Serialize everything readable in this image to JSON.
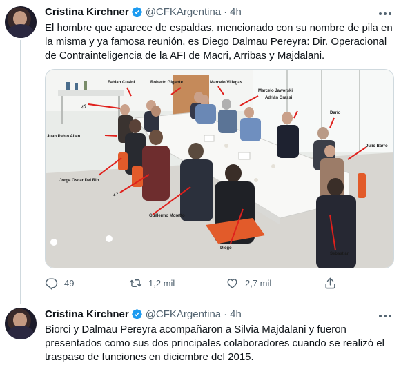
{
  "tweets": [
    {
      "author_name": "Cristina Kirchner",
      "handle": "@CFKArgentina",
      "separator": "·",
      "time": "4h",
      "text": "El hombre que aparece de espaldas, mencionado con su nombre de pila en la misma y ya famosa reunión, es Diego Dalmau Pereyra: Dir. Operacional de Contrainteligencia de la AFI de Macri, Arribas y Majdalani.",
      "photo_labels": {
        "fabian": "Fabian Cusini",
        "roberto": "Roberto Gigante",
        "marcelo_v": "Marcelo Villegas",
        "marcelo_j": "Marcelo Jaworski",
        "adrian": "Adrián Grassi",
        "dario": "Darío",
        "juan_pablo": "Juan Pablo Allen",
        "jorge": "Jorge Oscar Del Rio",
        "julio": "Julio Barro",
        "q1": "¿?",
        "q2": "¿?",
        "guillermo": "Guillermo Moretto",
        "diego": "Diego",
        "sebastian": "Sebastián"
      },
      "counts": {
        "replies": "49",
        "retweets": "1,2 mil",
        "likes": "2,7 mil"
      }
    },
    {
      "author_name": "Cristina Kirchner",
      "handle": "@CFKArgentina",
      "separator": "·",
      "time": "4h",
      "text": "Biorci y Dalmau Pereyra acompañaron a Silvia Majdalani y fueron presentados como sus dos principales colaboradores cuando se realizó el traspaso de funciones en diciembre del 2015."
    }
  ],
  "colors": {
    "text": "#0f1419",
    "secondary": "#536471",
    "verified": "#1d9bf0",
    "border": "#cfd9de",
    "annotation_red": "#e0201c"
  },
  "icons": [
    "verified-badge-icon",
    "more-options-icon",
    "reply-icon",
    "retweet-icon",
    "like-icon",
    "share-icon"
  ]
}
